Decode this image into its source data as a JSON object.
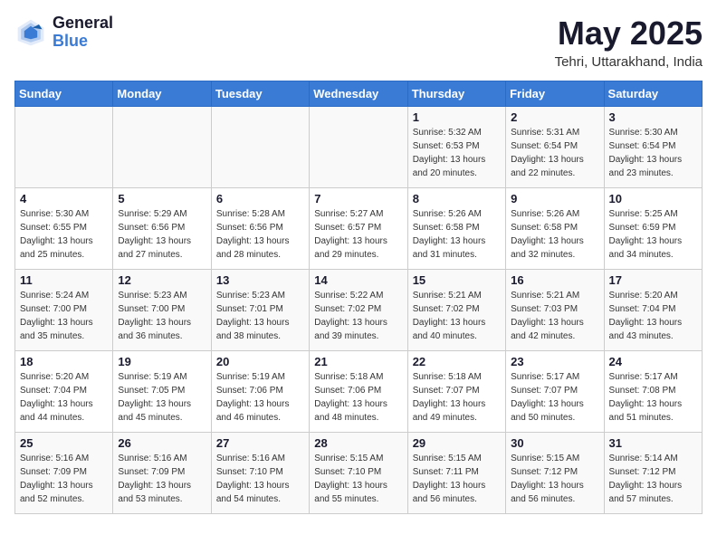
{
  "header": {
    "logo_general": "General",
    "logo_blue": "Blue",
    "title": "May 2025",
    "location": "Tehri, Uttarakhand, India"
  },
  "weekdays": [
    "Sunday",
    "Monday",
    "Tuesday",
    "Wednesday",
    "Thursday",
    "Friday",
    "Saturday"
  ],
  "weeks": [
    [
      {
        "day": "",
        "info": ""
      },
      {
        "day": "",
        "info": ""
      },
      {
        "day": "",
        "info": ""
      },
      {
        "day": "",
        "info": ""
      },
      {
        "day": "1",
        "info": "Sunrise: 5:32 AM\nSunset: 6:53 PM\nDaylight: 13 hours\nand 20 minutes."
      },
      {
        "day": "2",
        "info": "Sunrise: 5:31 AM\nSunset: 6:54 PM\nDaylight: 13 hours\nand 22 minutes."
      },
      {
        "day": "3",
        "info": "Sunrise: 5:30 AM\nSunset: 6:54 PM\nDaylight: 13 hours\nand 23 minutes."
      }
    ],
    [
      {
        "day": "4",
        "info": "Sunrise: 5:30 AM\nSunset: 6:55 PM\nDaylight: 13 hours\nand 25 minutes."
      },
      {
        "day": "5",
        "info": "Sunrise: 5:29 AM\nSunset: 6:56 PM\nDaylight: 13 hours\nand 27 minutes."
      },
      {
        "day": "6",
        "info": "Sunrise: 5:28 AM\nSunset: 6:56 PM\nDaylight: 13 hours\nand 28 minutes."
      },
      {
        "day": "7",
        "info": "Sunrise: 5:27 AM\nSunset: 6:57 PM\nDaylight: 13 hours\nand 29 minutes."
      },
      {
        "day": "8",
        "info": "Sunrise: 5:26 AM\nSunset: 6:58 PM\nDaylight: 13 hours\nand 31 minutes."
      },
      {
        "day": "9",
        "info": "Sunrise: 5:26 AM\nSunset: 6:58 PM\nDaylight: 13 hours\nand 32 minutes."
      },
      {
        "day": "10",
        "info": "Sunrise: 5:25 AM\nSunset: 6:59 PM\nDaylight: 13 hours\nand 34 minutes."
      }
    ],
    [
      {
        "day": "11",
        "info": "Sunrise: 5:24 AM\nSunset: 7:00 PM\nDaylight: 13 hours\nand 35 minutes."
      },
      {
        "day": "12",
        "info": "Sunrise: 5:23 AM\nSunset: 7:00 PM\nDaylight: 13 hours\nand 36 minutes."
      },
      {
        "day": "13",
        "info": "Sunrise: 5:23 AM\nSunset: 7:01 PM\nDaylight: 13 hours\nand 38 minutes."
      },
      {
        "day": "14",
        "info": "Sunrise: 5:22 AM\nSunset: 7:02 PM\nDaylight: 13 hours\nand 39 minutes."
      },
      {
        "day": "15",
        "info": "Sunrise: 5:21 AM\nSunset: 7:02 PM\nDaylight: 13 hours\nand 40 minutes."
      },
      {
        "day": "16",
        "info": "Sunrise: 5:21 AM\nSunset: 7:03 PM\nDaylight: 13 hours\nand 42 minutes."
      },
      {
        "day": "17",
        "info": "Sunrise: 5:20 AM\nSunset: 7:04 PM\nDaylight: 13 hours\nand 43 minutes."
      }
    ],
    [
      {
        "day": "18",
        "info": "Sunrise: 5:20 AM\nSunset: 7:04 PM\nDaylight: 13 hours\nand 44 minutes."
      },
      {
        "day": "19",
        "info": "Sunrise: 5:19 AM\nSunset: 7:05 PM\nDaylight: 13 hours\nand 45 minutes."
      },
      {
        "day": "20",
        "info": "Sunrise: 5:19 AM\nSunset: 7:06 PM\nDaylight: 13 hours\nand 46 minutes."
      },
      {
        "day": "21",
        "info": "Sunrise: 5:18 AM\nSunset: 7:06 PM\nDaylight: 13 hours\nand 48 minutes."
      },
      {
        "day": "22",
        "info": "Sunrise: 5:18 AM\nSunset: 7:07 PM\nDaylight: 13 hours\nand 49 minutes."
      },
      {
        "day": "23",
        "info": "Sunrise: 5:17 AM\nSunset: 7:07 PM\nDaylight: 13 hours\nand 50 minutes."
      },
      {
        "day": "24",
        "info": "Sunrise: 5:17 AM\nSunset: 7:08 PM\nDaylight: 13 hours\nand 51 minutes."
      }
    ],
    [
      {
        "day": "25",
        "info": "Sunrise: 5:16 AM\nSunset: 7:09 PM\nDaylight: 13 hours\nand 52 minutes."
      },
      {
        "day": "26",
        "info": "Sunrise: 5:16 AM\nSunset: 7:09 PM\nDaylight: 13 hours\nand 53 minutes."
      },
      {
        "day": "27",
        "info": "Sunrise: 5:16 AM\nSunset: 7:10 PM\nDaylight: 13 hours\nand 54 minutes."
      },
      {
        "day": "28",
        "info": "Sunrise: 5:15 AM\nSunset: 7:10 PM\nDaylight: 13 hours\nand 55 minutes."
      },
      {
        "day": "29",
        "info": "Sunrise: 5:15 AM\nSunset: 7:11 PM\nDaylight: 13 hours\nand 56 minutes."
      },
      {
        "day": "30",
        "info": "Sunrise: 5:15 AM\nSunset: 7:12 PM\nDaylight: 13 hours\nand 56 minutes."
      },
      {
        "day": "31",
        "info": "Sunrise: 5:14 AM\nSunset: 7:12 PM\nDaylight: 13 hours\nand 57 minutes."
      }
    ]
  ]
}
